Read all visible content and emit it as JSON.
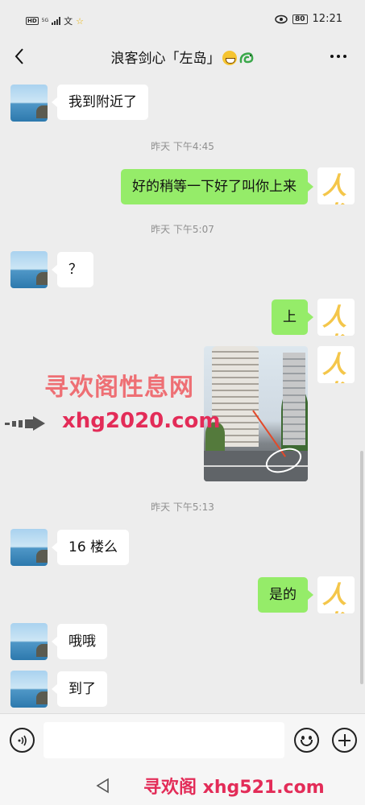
{
  "status_bar": {
    "hd": "HD",
    "network": "5G",
    "time": "12:21",
    "battery": "80"
  },
  "header": {
    "title": "浪客剑心「左岛」",
    "emojis": [
      "grinning-face",
      "dragon"
    ]
  },
  "messages": [
    {
      "side": "left",
      "text": "我到附近了"
    },
    {
      "type": "time",
      "text": "昨天 下午4:45"
    },
    {
      "side": "right",
      "text": "好的稍等一下好了叫你上来"
    },
    {
      "type": "time",
      "text": "昨天 下午5:07"
    },
    {
      "side": "left",
      "text": "？"
    },
    {
      "side": "right",
      "text": "上"
    },
    {
      "side": "right",
      "type": "image",
      "content": "photo of high-rise buildings and street"
    },
    {
      "type": "time",
      "text": "昨天 下午5:13"
    },
    {
      "side": "left",
      "text": "16 楼么"
    },
    {
      "side": "right",
      "text": "是的"
    },
    {
      "side": "left",
      "text": "哦哦"
    },
    {
      "side": "left",
      "text": "到了"
    }
  ],
  "watermark": {
    "title": "寻欢阁性息网",
    "url": "xhg2020.com",
    "bottom": "寻欢阁 xhg521.com"
  },
  "input": {
    "value": "",
    "placeholder": ""
  },
  "colors": {
    "background": "#ededed",
    "bubble_right": "#95ec69",
    "bubble_left": "#ffffff",
    "watermark": "#e32c58"
  },
  "icons": {
    "back": "chevron-left-icon",
    "more": "more-icon",
    "voice": "voice-icon",
    "emoji": "emoji-icon",
    "plus": "plus-icon",
    "nav_back": "triangle-back-icon"
  }
}
